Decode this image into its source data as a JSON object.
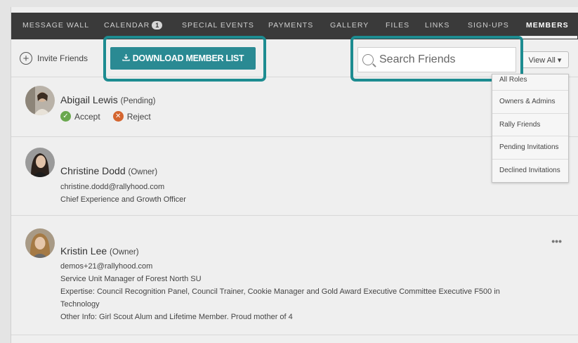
{
  "nav": {
    "items": [
      {
        "label": "MESSAGE WALL"
      },
      {
        "label": "CALENDAR",
        "badge": "1"
      },
      {
        "label": "SPECIAL EVENTS"
      },
      {
        "label": "PAYMENTS"
      },
      {
        "label": "GALLERY"
      },
      {
        "label": "FILES"
      },
      {
        "label": "LINKS"
      },
      {
        "label": "SIGN-UPS"
      },
      {
        "label": "MEMBERS"
      }
    ]
  },
  "toolbar": {
    "invite_label": "Invite Friends",
    "download_label": "DOWNLOAD MEMBER LIST",
    "search_placeholder": "Search Friends",
    "view_all_label": "View All ▾"
  },
  "dropdown": {
    "items": [
      "All Roles",
      "Owners & Admins",
      "Rally Friends",
      "Pending Invitations",
      "Declined Invitations"
    ]
  },
  "members": [
    {
      "name": "Abigail Lewis",
      "role": "(Pending)",
      "accept_label": "Accept",
      "reject_label": "Reject"
    },
    {
      "name": "Christine Dodd",
      "role": "(Owner)",
      "email": "christine.dodd@rallyhood.com",
      "title": "Chief Experience and Growth Officer"
    },
    {
      "name": "Kristin Lee",
      "role": "(Owner)",
      "email": "demos+21@rallyhood.com",
      "title": "Service Unit Manager of Forest North SU",
      "expertise": "Expertise: Council Recognition Panel, Council Trainer, Cookie Manager and Gold Award Executive Committee Executive F500 in",
      "expertise_cont": "Technology",
      "other_info": "Other Info: Girl Scout Alum and Lifetime Member. Proud mother of 4",
      "more_label": "•••"
    }
  ],
  "colors": {
    "accent": "#2a8a93",
    "highlight": "#1d8c91",
    "nav_bg": "#3a3a3a"
  }
}
